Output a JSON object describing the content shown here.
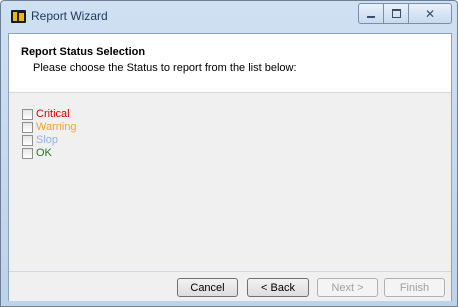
{
  "window": {
    "title": "Report Wizard"
  },
  "header": {
    "title": "Report Status Selection",
    "subtitle": "Please choose the Status to report from the list below:"
  },
  "options": [
    {
      "label": "Critical",
      "checked": false,
      "color": "#e00000"
    },
    {
      "label": "Warning",
      "checked": false,
      "color": "#f5a623"
    },
    {
      "label": "Slop",
      "checked": false,
      "color": "#8fb4e3"
    },
    {
      "label": "OK",
      "checked": false,
      "color": "#1e7d1e"
    }
  ],
  "buttons": {
    "cancel": "Cancel",
    "back": "< Back",
    "next": "Next >",
    "finish": "Finish"
  }
}
